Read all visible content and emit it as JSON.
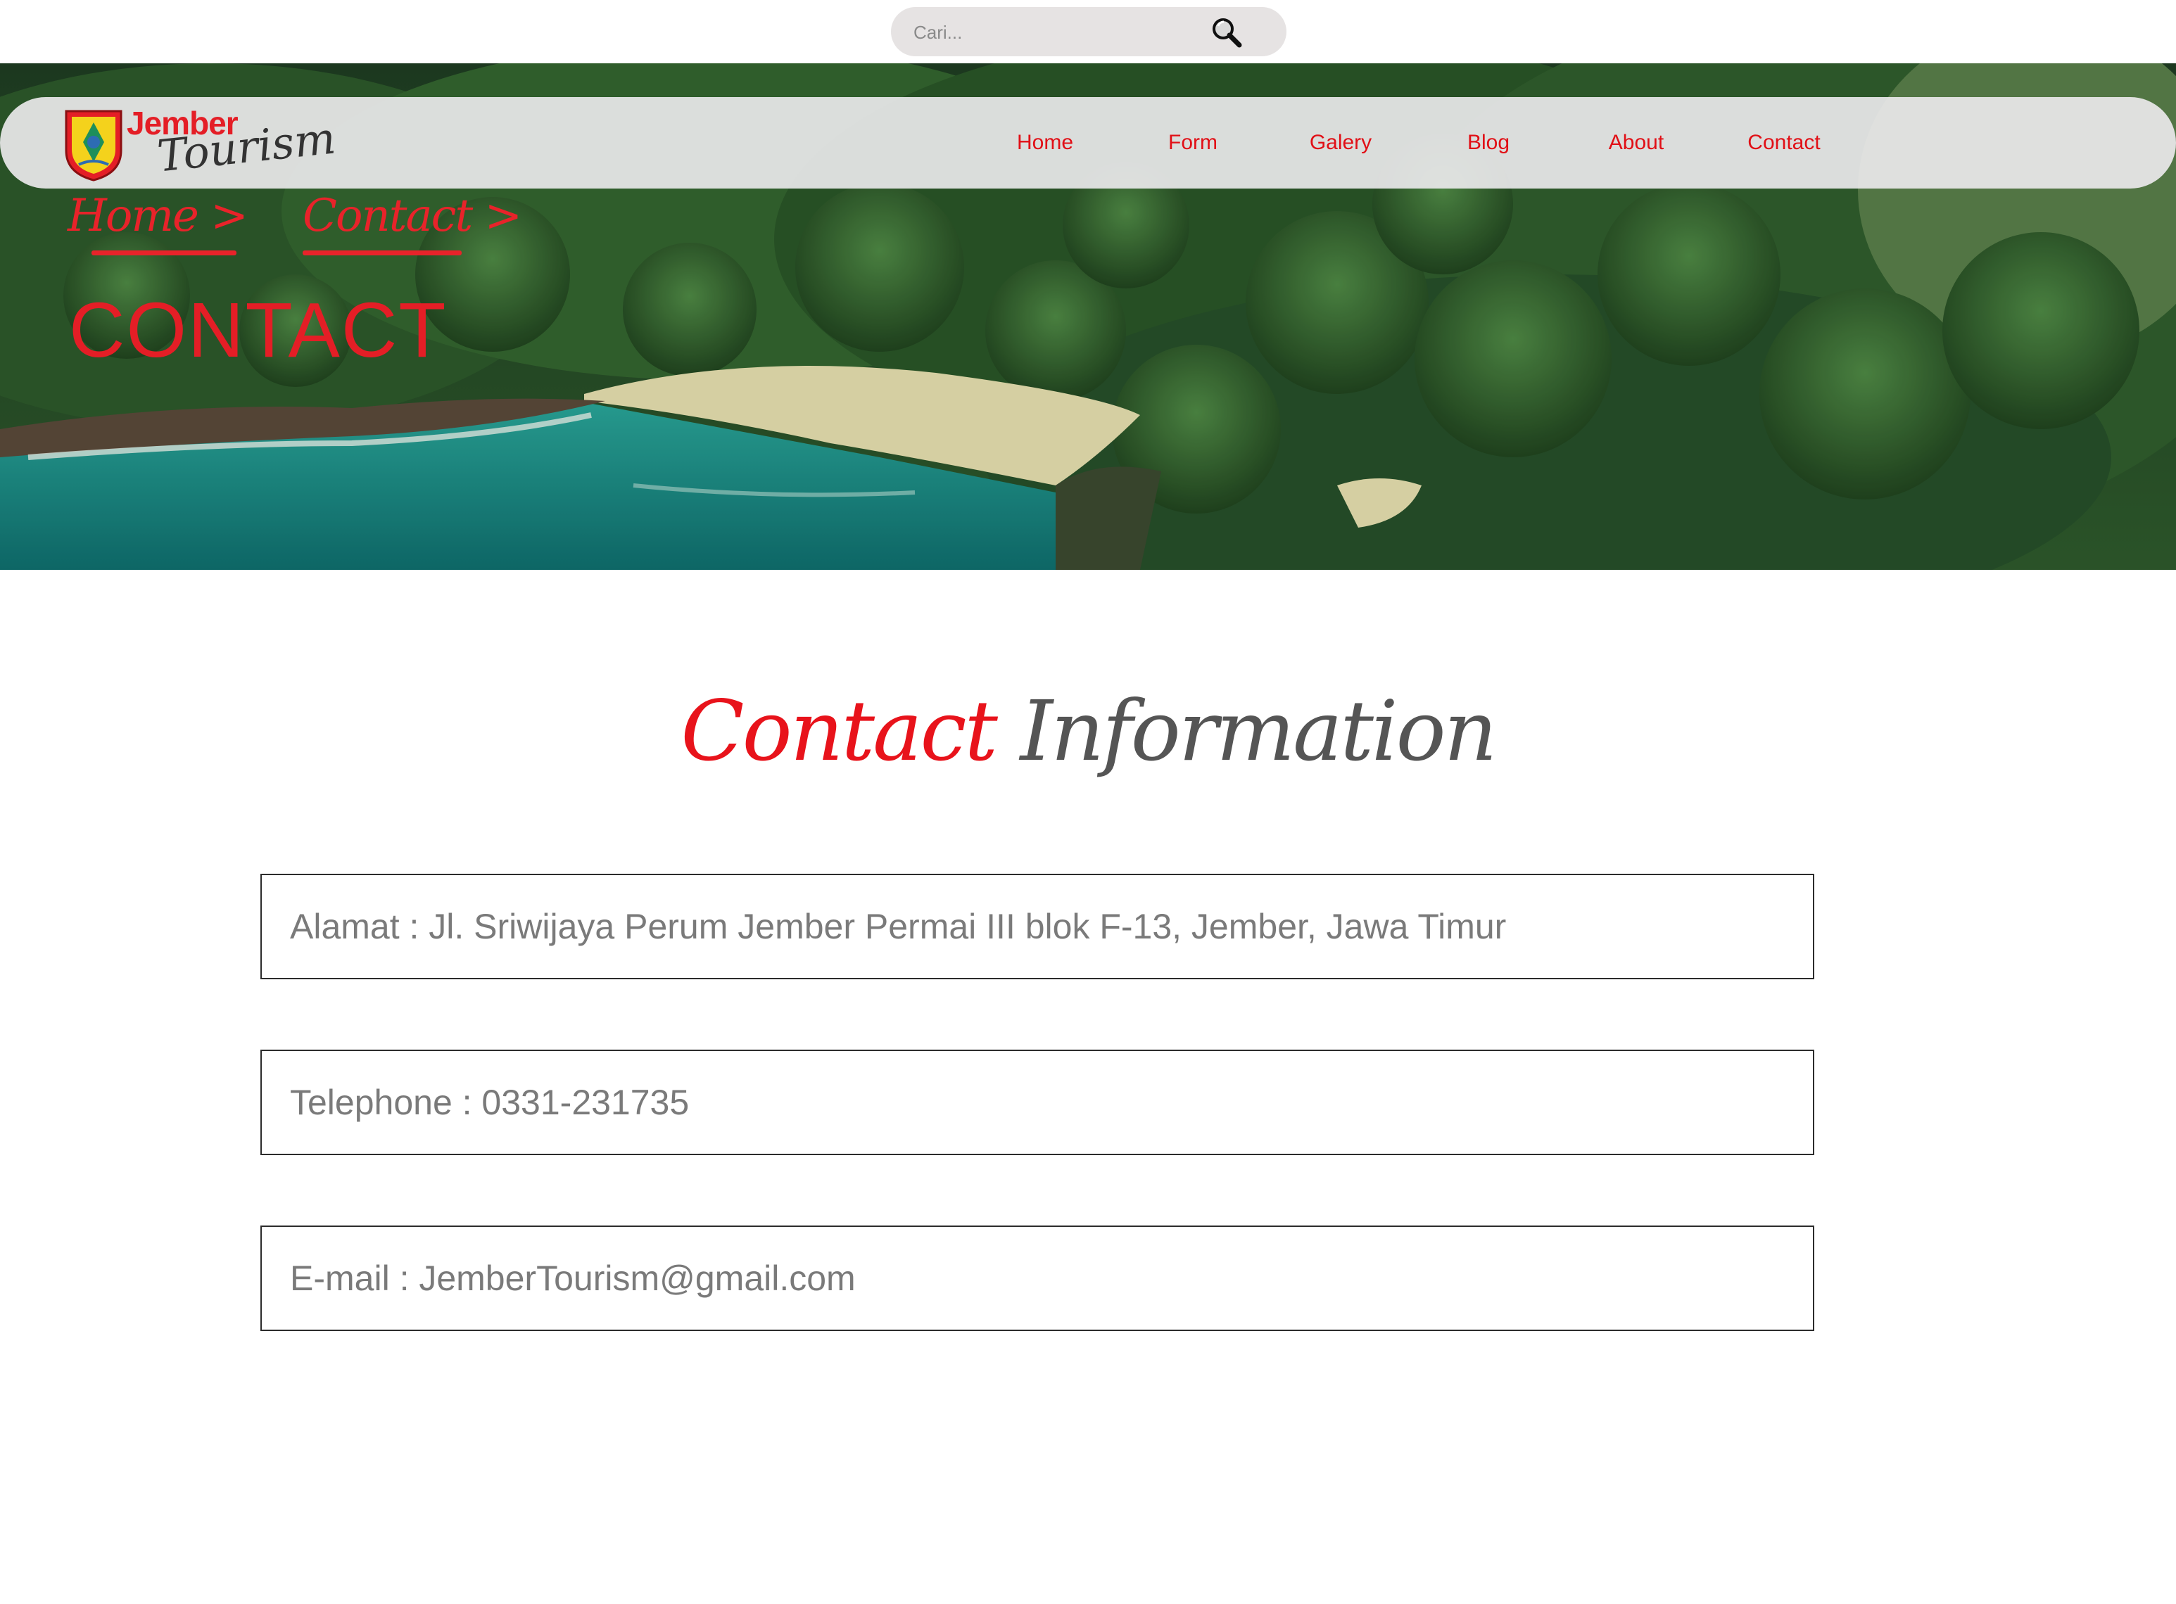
{
  "search": {
    "placeholder": "Cari..."
  },
  "brand": {
    "title_line1": "Jember",
    "title_line2": "Tourism",
    "primary_color": "#e41e26"
  },
  "nav": {
    "items": [
      {
        "label": "Home"
      },
      {
        "label": "Form"
      },
      {
        "label": "Galery"
      },
      {
        "label": "Blog"
      },
      {
        "label": "About"
      },
      {
        "label": "Contact"
      }
    ]
  },
  "breadcrumb": {
    "home": "Home >",
    "current": "Contact >"
  },
  "page": {
    "title": "CONTACT"
  },
  "section": {
    "heading_accent": "Contact",
    "heading_rest": "Information"
  },
  "contact": {
    "address": "Alamat : Jl. Sriwijaya Perum Jember Permai III blok F-13, Jember, Jawa Timur",
    "telephone": "Telephone : 0331-231735",
    "email": "E-mail : JemberTourism@gmail.com"
  },
  "icons": {
    "search": "search-icon",
    "logo": "jember-shield-icon"
  }
}
